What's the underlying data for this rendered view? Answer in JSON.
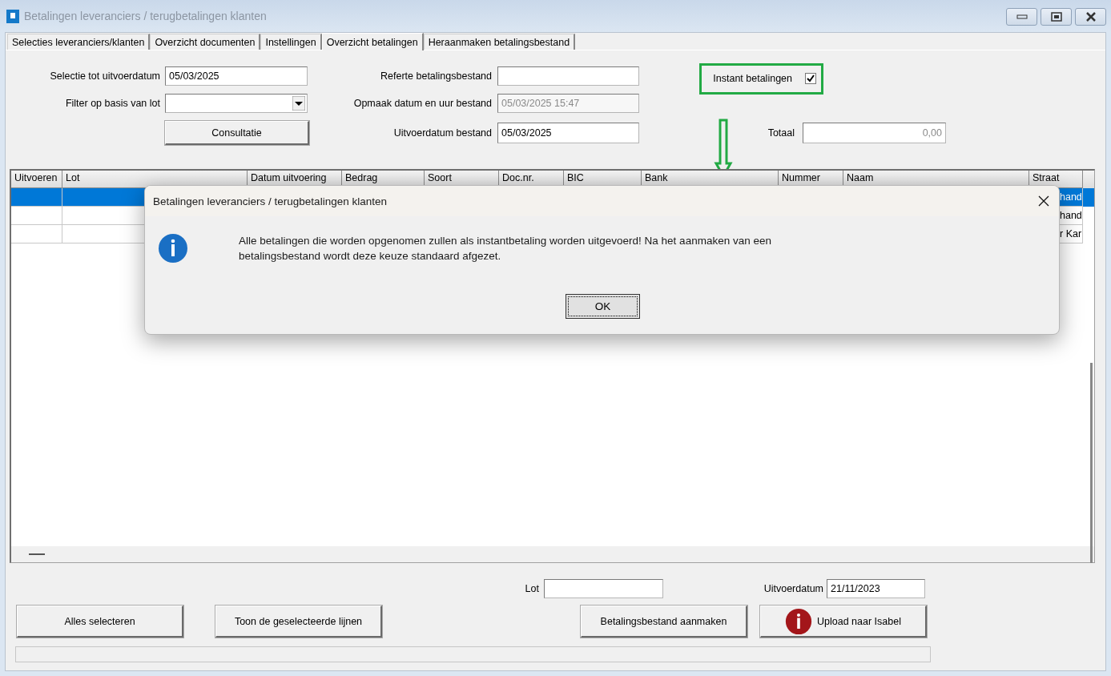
{
  "window": {
    "title": "Betalingen leveranciers / terugbetalingen klanten"
  },
  "tabs": [
    {
      "label": "Selecties leveranciers/klanten",
      "selected": false
    },
    {
      "label": "Overzicht documenten",
      "selected": false
    },
    {
      "label": "Instellingen",
      "selected": false
    },
    {
      "label": "Overzicht betalingen",
      "selected": true
    },
    {
      "label": "Heraanmaken betalingsbestand",
      "selected": false
    }
  ],
  "form": {
    "selection_date": {
      "label": "Selectie tot uitvoerdatum",
      "value": "05/03/2025"
    },
    "lot_filter": {
      "label": "Filter op basis van lot"
    },
    "consult_button": "Consultatie",
    "file_reference": {
      "label": "Referte betalingsbestand"
    },
    "file_created": {
      "label": "Opmaak datum en uur bestand",
      "value": "05/03/2025  15:47",
      "disabled": true
    },
    "file_date": {
      "label": "Uitvoerdatum bestand",
      "value": "05/03/2025"
    },
    "instant": {
      "label": "Instant betalingen",
      "checked": true
    },
    "total": {
      "label": "Totaal",
      "value": "0,00"
    }
  },
  "table": {
    "columns": [
      "Uitvoeren",
      "Lot",
      "Datum uitvoering",
      "Bedrag",
      "Soort",
      "Doc.nr.",
      "BIC",
      "Bank",
      "Nummer",
      "Naam",
      "Straat"
    ],
    "rows": [
      {
        "selected": true,
        "street": "hand"
      },
      {
        "selected": false,
        "street": "hand"
      },
      {
        "selected": false,
        "street": "r Kar"
      }
    ]
  },
  "footer": {
    "lot": {
      "label": "Lot"
    },
    "date": {
      "label": "Uitvoerdatum",
      "value": "21/11/2023"
    },
    "buttons": [
      {
        "label": "Alles selecteren",
        "kind": "plain"
      },
      {
        "label": "Toon de geselecteerde lijnen",
        "kind": "plain"
      },
      {
        "label": "Betalingsbestand aanmaken",
        "kind": "plain"
      },
      {
        "label": "Upload naar Isabel",
        "kind": "upload"
      }
    ]
  },
  "dialog": {
    "title": "Betalingen leveranciers / terugbetalingen klanten",
    "message": "Alle betalingen die worden opgenomen zullen als instantbetaling worden uitgevoerd! Na het aanmaken van een betalingsbestand wordt deze keuze standaard afgezet.",
    "button": "OK"
  }
}
